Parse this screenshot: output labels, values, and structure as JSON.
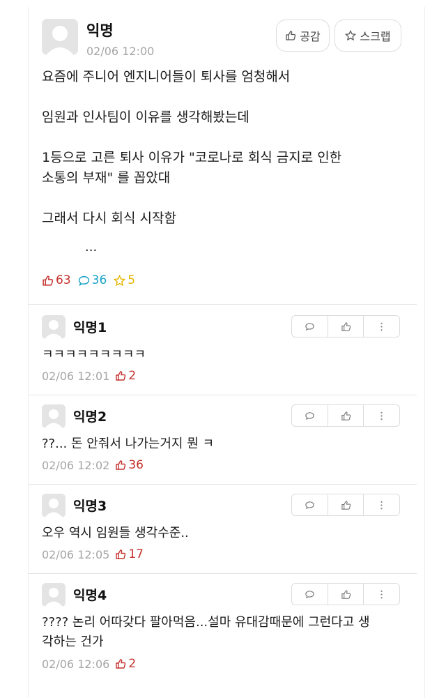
{
  "post": {
    "author": "익명",
    "time": "02/06 12:00",
    "like_button": "공감",
    "scrap_button": "스크랩",
    "lines": [
      "요즘에 주니어 엔지니어들이 퇴사를 엄청해서",
      "임원과 인사팀이 이유를 생각해봤는데",
      "1등으로 고른 퇴사 이유가 \"코로나로 회식 금지로 인한",
      "소통의 부재\" 를 꼽았대",
      "그래서 다시 회식 시작함",
      "..."
    ],
    "stats": {
      "likes": "63",
      "comments": "36",
      "scraps": "5"
    }
  },
  "comments": [
    {
      "author": "익명1",
      "text": "ㅋㅋㅋㅋㅋㅋㅋㅋㅋ",
      "time": "02/06 12:01",
      "likes": "2"
    },
    {
      "author": "익명2",
      "text": "??... 돈 안줘서 나가는거지 뭔 ㅋ",
      "time": "02/06 12:02",
      "likes": "36"
    },
    {
      "author": "익명3",
      "text": "오우 역시 임원들 생각수준..",
      "time": "02/06 12:05",
      "likes": "17"
    },
    {
      "author": "익명4",
      "text": "???? 논리 어따갖다 팔아먹음...설마 유대감때문에 그런다고 생각하는 건가",
      "time": "02/06 12:06",
      "likes": "2"
    }
  ],
  "colors": {
    "like": "#c4322d",
    "comment": "#1aa3c7",
    "scrap": "#e6b600",
    "muted": "#a5a5a5"
  },
  "icons": [
    "thumbs-up-icon",
    "star-icon",
    "speech-bubble-icon",
    "more-vertical-icon",
    "avatar-icon"
  ]
}
